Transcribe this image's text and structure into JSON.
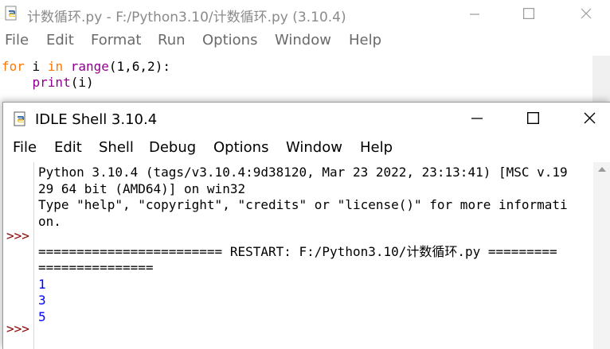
{
  "editor": {
    "title": "计数循环.py - F:/Python3.10/计数循环.py (3.10.4)",
    "menu": [
      "File",
      "Edit",
      "Format",
      "Run",
      "Options",
      "Window",
      "Help"
    ],
    "code": {
      "line1": {
        "kw1": "for",
        "t1": " i ",
        "kw2": "in",
        "t2": " ",
        "bi": "range",
        "t3": "(1,6,2):"
      },
      "line2": {
        "indent": "    ",
        "bi": "print",
        "t1": "(i)"
      }
    }
  },
  "shell": {
    "title": "IDLE Shell 3.10.4",
    "menu": [
      "File",
      "Edit",
      "Shell",
      "Debug",
      "Options",
      "Window",
      "Help"
    ],
    "prompt": ">>>",
    "lines": [
      "Python 3.10.4 (tags/v3.10.4:9d38120, Mar 23 2022, 23:13:41) [MSC v.19",
      "29 64 bit (AMD64)] on win32",
      "Type \"help\", \"copyright\", \"credits\" or \"license()\" for more informati",
      "on.",
      "======================== RESTART: F:/Python3.10/计数循环.py =========",
      "===============",
      "1",
      "3",
      "5"
    ]
  },
  "colors": {
    "keyword": "#ff7700",
    "builtin": "#900090",
    "output": "#0000ff",
    "prompt": "#8b0000"
  },
  "icons": [
    "python-file-icon",
    "minimize-icon",
    "maximize-icon",
    "close-icon"
  ]
}
